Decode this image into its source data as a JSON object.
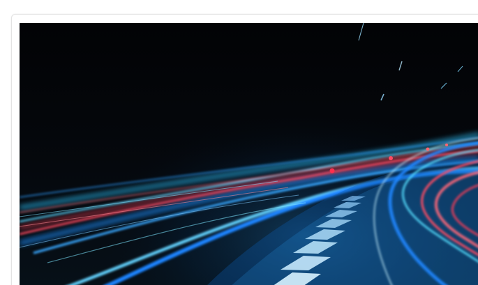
{
  "card": {
    "image": {
      "subject": "light-trail-road"
    }
  },
  "colors": {
    "background": "#ffffff",
    "card_border": "#e3e3e3",
    "sky": "#040507",
    "trail_blue": "#39a7ff",
    "trail_cyan": "#59d7ff",
    "trail_red": "#ff4b62",
    "trail_white": "#eaf6ff"
  }
}
